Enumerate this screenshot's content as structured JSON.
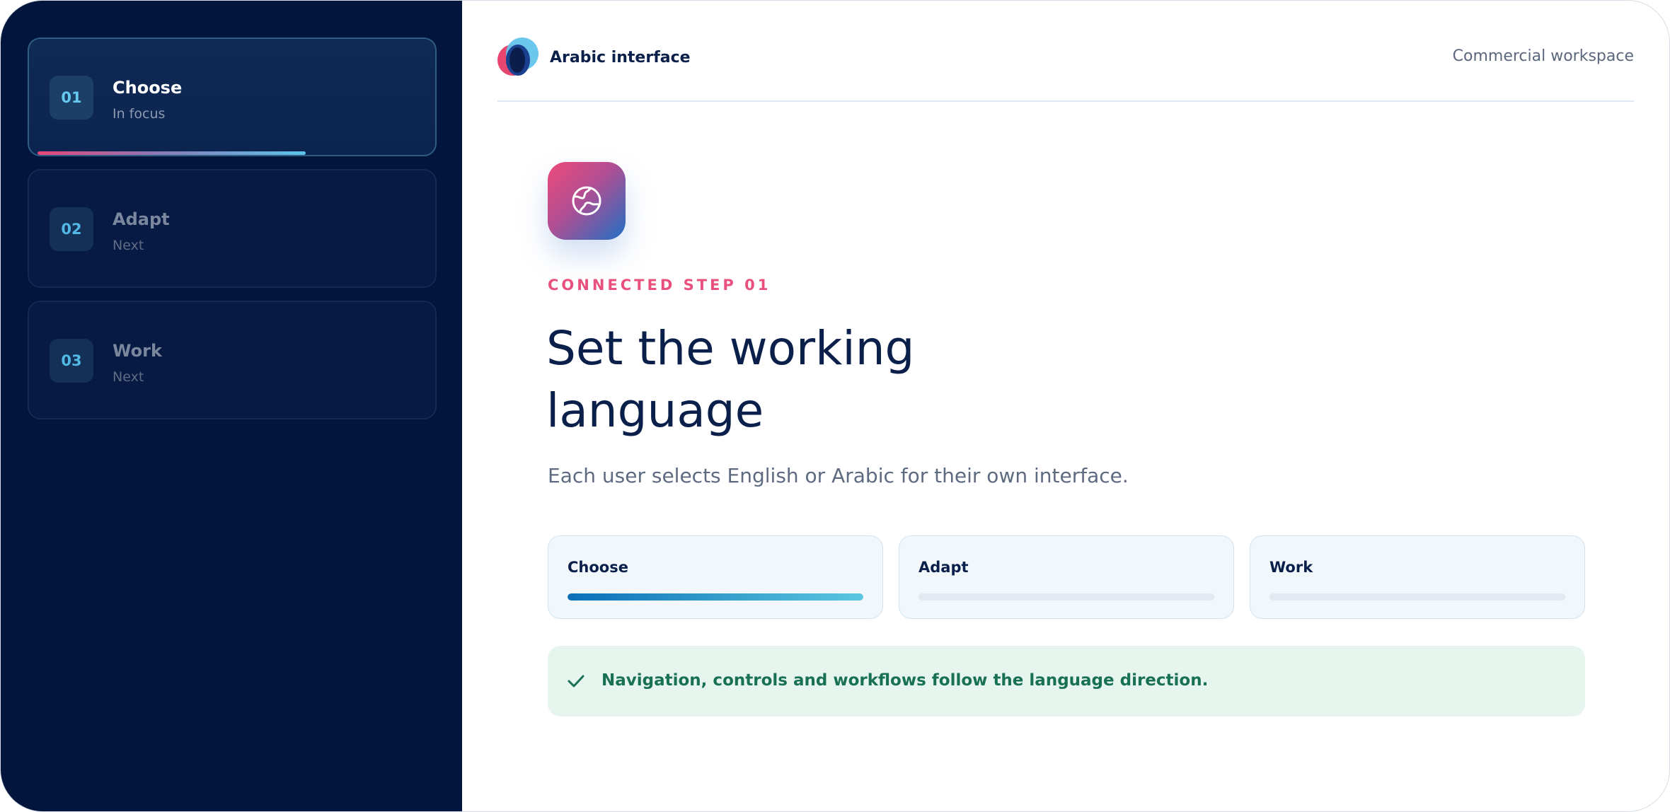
{
  "sidebar": {
    "steps": [
      {
        "number": "01",
        "title": "Choose",
        "status": "In focus",
        "active": true,
        "progress": 0.66
      },
      {
        "number": "02",
        "title": "Adapt",
        "status": "Next",
        "active": false
      },
      {
        "number": "03",
        "title": "Work",
        "status": "Next",
        "active": false
      }
    ]
  },
  "header": {
    "brand_name": "Arabic interface",
    "workspace": "Commercial workspace"
  },
  "main": {
    "icon": "globe-icon",
    "eyebrow": "CONNECTED STEP 01",
    "headline": "Set the working language",
    "description": "Each user selects English or Arabic for their own interface.",
    "cards": [
      {
        "label": "Choose",
        "progress": 1.0
      },
      {
        "label": "Adapt",
        "progress": 0
      },
      {
        "label": "Work",
        "progress": 0
      }
    ],
    "notice": {
      "icon": "check-icon",
      "text": "Navigation, controls and workflows follow the language direction."
    }
  },
  "colors": {
    "sidebar_bg": "#02153d",
    "accent_pink": "#e8507d",
    "accent_blue": "#0a6fb8",
    "heading": "#0a1f4a",
    "success": "#187055"
  }
}
